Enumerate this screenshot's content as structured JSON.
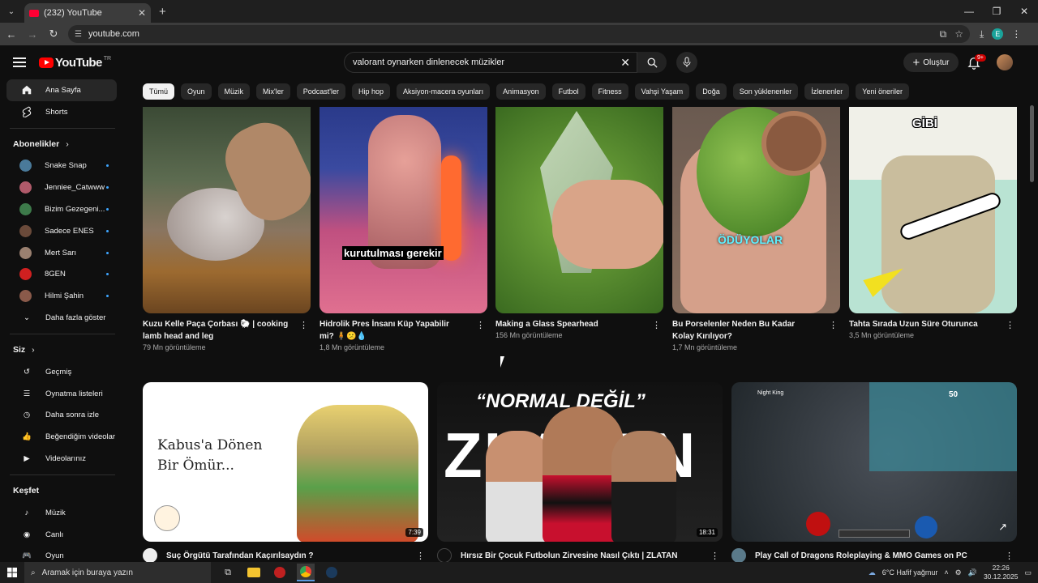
{
  "browser": {
    "tab_title": "(232) YouTube",
    "url": "youtube.com",
    "profile_letter": "E"
  },
  "header": {
    "logo_text": "YouTube",
    "region": "TR",
    "search_query": "valorant oynarken dinlenecek müzikler",
    "create_label": "Oluştur",
    "notification_count": "9+"
  },
  "sidebar": {
    "main": [
      {
        "label": "Ana Sayfa",
        "icon": "home-icon"
      },
      {
        "label": "Shorts",
        "icon": "shorts-icon"
      }
    ],
    "subscriptions_title": "Abonelikler",
    "subscriptions": [
      {
        "label": "Snake Snap",
        "color": "#4a7a9a"
      },
      {
        "label": "Jenniee_Catwww",
        "color": "#b05a6a"
      },
      {
        "label": "Bizim Gezegeni...",
        "color": "#3d7a4a"
      },
      {
        "label": "Sadece ENES",
        "color": "#6a4a3a"
      },
      {
        "label": "Mert Sarı",
        "color": "#9a8070"
      },
      {
        "label": "8GEN",
        "color": "#d02020"
      },
      {
        "label": "Hilmi Şahin",
        "color": "#8a5a4a"
      }
    ],
    "show_more": "Daha fazla göster",
    "you_title": "Siz",
    "you_items": [
      {
        "label": "Geçmiş",
        "icon": "history-icon"
      },
      {
        "label": "Oynatma listeleri",
        "icon": "playlists-icon"
      },
      {
        "label": "Daha sonra izle",
        "icon": "watch-later-icon"
      },
      {
        "label": "Beğendiğim videolar",
        "icon": "liked-icon"
      },
      {
        "label": "Videolarınız",
        "icon": "your-videos-icon"
      }
    ],
    "explore_title": "Keşfet",
    "explore_items": [
      {
        "label": "Müzik",
        "icon": "music-icon"
      },
      {
        "label": "Canlı",
        "icon": "live-icon"
      },
      {
        "label": "Oyun",
        "icon": "gaming-icon"
      }
    ]
  },
  "chips": [
    "Tümü",
    "Oyun",
    "Müzik",
    "Mix'ler",
    "Podcast'ler",
    "Hip hop",
    "Aksiyon-macera oyunları",
    "Animasyon",
    "Futbol",
    "Fitness",
    "Vahşi Yaşam",
    "Doğa",
    "Son yüklenenler",
    "İzlenenler",
    "Yeni öneriler"
  ],
  "shorts": [
    {
      "title": "Kuzu Kelle Paça Çorbası 🐑 | cooking lamb head and leg",
      "views": "79 Mn görüntüleme"
    },
    {
      "title": "Hidrolik Pres İnsanı Küp Yapabilir mi? 🧍😕💧",
      "views": "1,8 Mn görüntüleme",
      "overlay": "kurutulması gerekir"
    },
    {
      "title": "Making a Glass Spearhead",
      "views": "156 Mn görüntüleme"
    },
    {
      "title": "Bu Porselenler Neden Bu Kadar Kolay Kırılıyor?",
      "views": "1,7 Mn görüntüleme",
      "overlay": "ÖDÜYOLAR"
    },
    {
      "title": "Tahta Sırada Uzun Süre Oturunca",
      "views": "3,5 Mn görüntüleme",
      "overlay": "GİBİ"
    }
  ],
  "videos": [
    {
      "title": "Suç Örgütü Tarafından Kaçırılsaydın ?",
      "duration": "7:39",
      "thumb_text": "Kabus'a Dönen\nBir Ömür..."
    },
    {
      "title": "Hırsız Bir Çocuk Futbolun Zirvesine Nasıl Çıktı | ZLATAN",
      "duration": "18:31",
      "thumb_top": "“NORMAL DEĞİL”",
      "thumb_big": "ZLATAN"
    },
    {
      "title": "Play Call of Dragons Roleplaying & MMO Games on PC",
      "duration": "",
      "hud_name": "Night King",
      "hud_level": "50"
    }
  ],
  "taskbar": {
    "search_placeholder": "Aramak için buraya yazın",
    "weather": "6°C  Hafif yağmur",
    "time": "22:26",
    "date": "30.12.2025"
  }
}
